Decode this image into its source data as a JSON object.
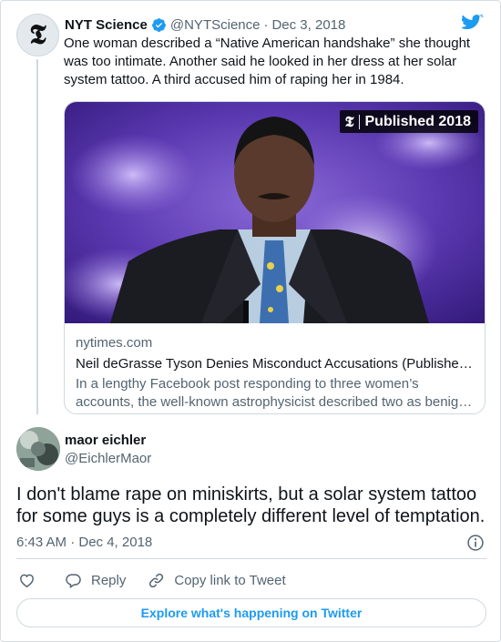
{
  "quoted_tweet": {
    "author_name": "NYT Science",
    "handle": "@NYTScience",
    "separator": "·",
    "date": "Dec 3, 2018",
    "avatar_icon": "nyt-t-logo",
    "verified_icon": "verified-badge-icon",
    "text": "One woman described a “Native American handshake” she thought was too intimate. Another said he looked in her dress at her solar system tattoo. A third accused him of raping her in 1984.",
    "card": {
      "image_badge": "Published 2018",
      "domain": "nytimes.com",
      "title": "Neil deGrasse Tyson Denies Misconduct Accusations (Publishe…",
      "description_line1": "In a lengthy Facebook post responding to three women’s",
      "description_line2": "accounts, the well-known astrophysicist described two as benig…"
    }
  },
  "reply_tweet": {
    "author_name": "maor eichler",
    "handle": "@EichlerMaor",
    "text": "I don't blame rape on miniskirts, but a solar system tattoo for some guys is a completely different level of temptation.",
    "time": "6:43 AM · Dec 4, 2018"
  },
  "actions": {
    "reply_label": "Reply",
    "copy_label": "Copy link to Tweet",
    "icons": [
      "heart-icon",
      "reply-bubble-icon",
      "link-icon",
      "info-icon",
      "twitter-bird-icon"
    ]
  },
  "explore_label": "Explore what's happening on Twitter",
  "colors": {
    "accent": "#1d9bf0",
    "text": "#0f1419",
    "secondary": "#536471",
    "border": "#cfd9de"
  }
}
